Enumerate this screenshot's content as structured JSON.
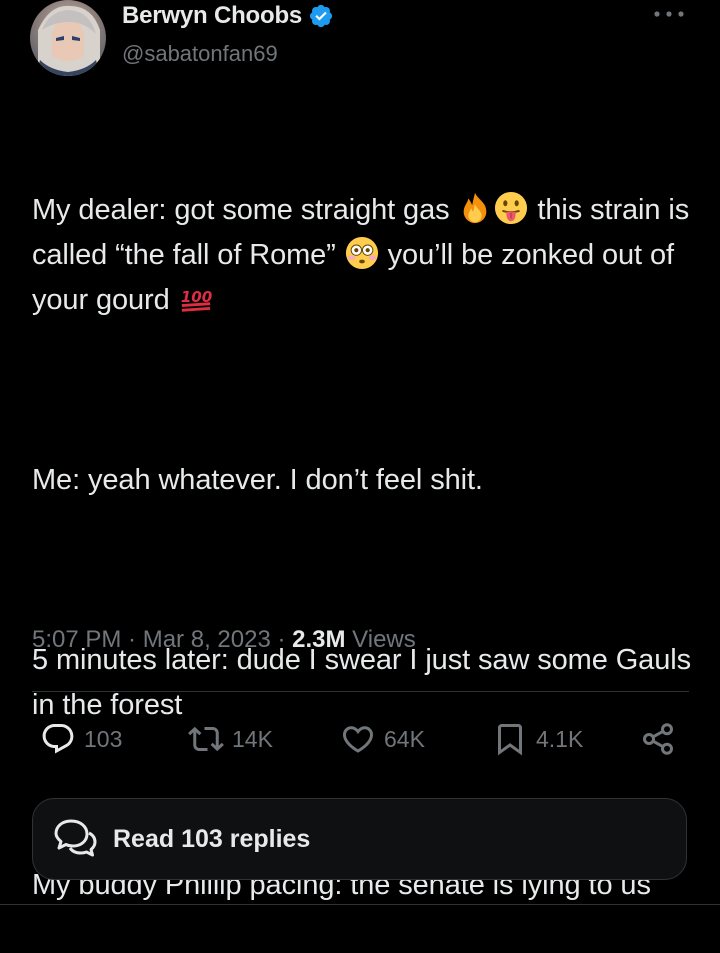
{
  "author": {
    "name": "Berwyn Choobs",
    "handle": "@sabatonfan69",
    "verified": true
  },
  "tweet": {
    "line1_a": "My dealer: got some straight gas ",
    "line1_b": " this strain is called “the fall of Rome” ",
    "line1_c": " you’ll be zonked out of your gourd ",
    "para2": "Me: yeah whatever. I don’t feel shit.",
    "para3": "5 minutes later: dude I swear I just saw some Gauls in the forest",
    "para4": "My buddy Phillip pacing: the senate is lying to us",
    "emojis": [
      "fire",
      "tongue-out-face",
      "flushed-face",
      "hundred-points"
    ]
  },
  "meta": {
    "time": "5:07 PM",
    "date": "Mar 8, 2023",
    "views_count": "2.3M",
    "views_label": "Views",
    "separator": " · "
  },
  "actions": {
    "replies": "103",
    "reposts": "14K",
    "likes": "64K",
    "bookmarks": "4.1K"
  },
  "read_replies": {
    "label": "Read 103 replies"
  },
  "colors": {
    "background": "#000000",
    "text": "#e7e9ea",
    "secondary": "#71767b",
    "verified": "#1d9bf0",
    "border": "#2f3336"
  }
}
